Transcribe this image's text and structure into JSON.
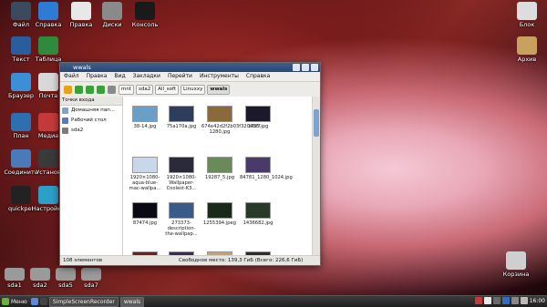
{
  "desktop": {
    "left_icons": [
      {
        "label": "Файл",
        "icon": "monitor-icon",
        "color": "#3b4a5c"
      },
      {
        "label": "Справка",
        "icon": "help-icon",
        "color": "#2e7bd6"
      },
      {
        "label": "Правка",
        "icon": "document-icon",
        "color": "#e8e8e8"
      },
      {
        "label": "Диски",
        "icon": "drive-icon",
        "color": "#8a8a8a"
      },
      {
        "label": "Консоль",
        "icon": "terminal-icon",
        "color": "#1a1a1a"
      },
      {
        "label": "Текст",
        "icon": "word-icon",
        "color": "#2a5d9e"
      },
      {
        "label": "Таблица",
        "icon": "spreadsheet-icon",
        "color": "#2f8a3c"
      },
      {
        "label": "Браузер",
        "icon": "globe-icon",
        "color": "#3a8fd6"
      },
      {
        "label": "Почта",
        "icon": "mail-icon",
        "color": "#d8d8d8"
      },
      {
        "label": "План",
        "icon": "calendar-icon",
        "color": "#2d6fb0"
      },
      {
        "label": "Медиа",
        "icon": "media-icon",
        "color": "#c43a3a"
      },
      {
        "label": "Соединить",
        "icon": "connect-icon",
        "color": "#4a7ab8"
      },
      {
        "label": "Установ",
        "icon": "install-icon",
        "color": "#3a3a3a"
      },
      {
        "label": "quickpet",
        "icon": "bomb-icon",
        "color": "#222222"
      },
      {
        "label": "Настройки",
        "icon": "settings-icon",
        "color": "#2aa0c8"
      }
    ],
    "right_icons": [
      {
        "label": "Блок",
        "icon": "lock-icon",
        "color": "#dddddd"
      },
      {
        "label": "Архив",
        "icon": "archive-icon",
        "color": "#c8a060"
      },
      {
        "label": "Корзина",
        "icon": "trash-icon",
        "color": "#cfcfcf"
      }
    ],
    "drives": [
      "sda1",
      "sda2",
      "sda5",
      "sda7"
    ]
  },
  "window": {
    "title": "wwals",
    "menu": [
      "Файл",
      "Правка",
      "Вид",
      "Закладки",
      "Перейти",
      "Инструменты",
      "Справка"
    ],
    "breadcrumbs": [
      "mnt",
      "sda2",
      "All_soft",
      "Linuxxy",
      "wwals"
    ],
    "sidebar_header": "Точки входа",
    "sidebar_items": [
      "Домашняя пап...",
      "Рабочий стол",
      "sda2"
    ],
    "files": [
      {
        "name": "38-14.jpg",
        "color": "#6aa0c8"
      },
      {
        "name": "75a170a.jpg",
        "color": "#2f3d5c"
      },
      {
        "name": "674e42d2f2b03f32005f7-1280.jpg",
        "color": "#8a6a3a"
      },
      {
        "name": "1435.jpg",
        "color": "#1a1a2a"
      },
      {
        "name": "1920×1080-aqua-blue-mac-wallpa...",
        "color": "#c8d8e8"
      },
      {
        "name": "1920×1080-Wallpaper-Coolest-K3...",
        "color": "#2a2a3a"
      },
      {
        "name": "19287_5.jpg",
        "color": "#6a8a5a"
      },
      {
        "name": "84781_1280_1024.jpg",
        "color": "#4a3a6a"
      },
      {
        "name": "87474.jpg",
        "color": "#0a0a14"
      },
      {
        "name": "273373-description-the-wallpap...",
        "color": "#3a5a8a"
      },
      {
        "name": "1255394.jpeg",
        "color": "#1a2a1a"
      },
      {
        "name": "1436682.jpg",
        "color": "#2a3a2a"
      },
      {
        "name": "",
        "color": "#7a1a1a"
      },
      {
        "name": "",
        "color": "#3a2a5a"
      },
      {
        "name": "",
        "color": "#c8a070"
      },
      {
        "name": "",
        "color": "#2a2a2a"
      }
    ],
    "status_count": "108 элементов",
    "status_free": "Свободное место: 139,3 ГиБ (Всего: 226,6 ГиБ)"
  },
  "panel": {
    "menu": "Меню",
    "tasks": [
      "SimpleScreenRecorder",
      "wwals"
    ],
    "clock": "16:00"
  }
}
